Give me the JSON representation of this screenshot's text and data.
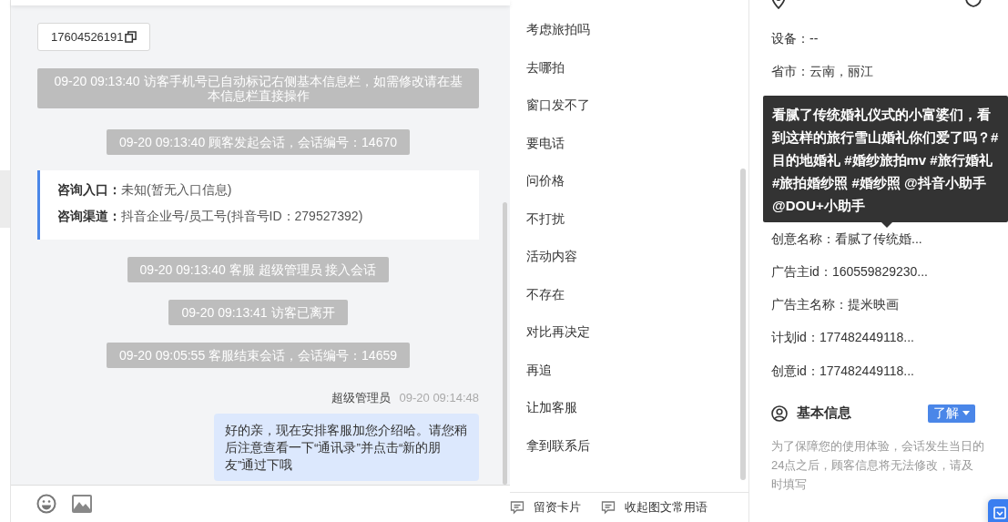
{
  "chat": {
    "messages": [
      {
        "kind": "contact",
        "phone": "17604526191"
      },
      {
        "kind": "system",
        "text": "09-20 09:13:40 访客手机号已自动标记右侧基本信息栏，如需修改请在基本信息栏直接操作"
      },
      {
        "kind": "system",
        "text": "09-20 09:13:40 顾客发起会话，会话编号：14670"
      },
      {
        "kind": "entry",
        "fields": [
          {
            "label": "咨询入口：",
            "value": "未知(暂无入口信息)"
          },
          {
            "label": "咨询渠道：",
            "value": "抖音企业号/员工号(抖音号ID：279527392)"
          }
        ]
      },
      {
        "kind": "system",
        "text": "09-20 09:13:40 客服 超级管理员 接入会话"
      },
      {
        "kind": "system",
        "text": "09-20 09:13:41 访客已离开"
      },
      {
        "kind": "system",
        "text": "09-20 09:05:55 客服结束会话，会话编号：14659"
      },
      {
        "kind": "agent",
        "sender": "超级管理员",
        "time": "09-20 09:14:48",
        "text": "好的亲，现在安排客服加您介绍哈。请您稍后注意查看一下“通讯录”并点击“新的朋友”通过下哦"
      }
    ]
  },
  "quick_replies": [
    "考虑旅拍吗",
    "去哪拍",
    "窗口发不了",
    "要电话",
    "问价格",
    "不打扰",
    "活动内容",
    "不存在",
    "对比再决定",
    "再追",
    "让加客服",
    "拿到联系后"
  ],
  "quick_toolbar": [
    "留资卡片",
    "收起图文常用语"
  ],
  "source_info": {
    "fields": [
      "设备：--",
      "省市：云南，丽江",
      "创意名称：看腻了传统婚...",
      "广告主id：160559829230...",
      "广告主名称：提米映画",
      "计划id：177482449118...",
      "创意id：177482449118..."
    ]
  },
  "tooltip": "看腻了传统婚礼仪式的小富婆们，看到这样的旅行雪山婚礼你们爱了吗？#目的地婚礼 #婚纱旅拍mv #旅行婚礼 #旅拍婚纱照 #婚纱照 @抖音小助手 @DOU+小助手",
  "basic_info": {
    "title": "基本信息",
    "button": "了解",
    "notice": "为了保障您的使用体验，会话发生当日的24点之后，顾客信息将无法修改，请及时填写"
  }
}
